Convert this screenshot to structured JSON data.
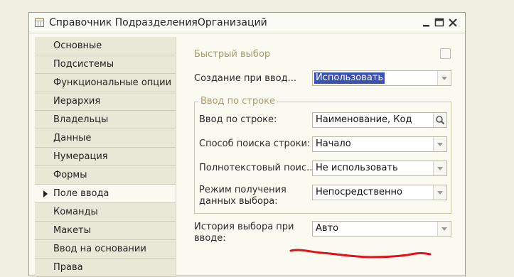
{
  "window": {
    "title": "Справочник ПодразделенияОрганизаций",
    "icons": {
      "app": "table-icon",
      "minimize": "minimize-icon",
      "maximize": "maximize-icon",
      "close": "close-icon"
    }
  },
  "sidebar": {
    "items": [
      {
        "label": "Основные"
      },
      {
        "label": "Подсистемы"
      },
      {
        "label": "Функциональные опции"
      },
      {
        "label": "Иерархия"
      },
      {
        "label": "Владельцы"
      },
      {
        "label": "Данные"
      },
      {
        "label": "Нумерация"
      },
      {
        "label": "Формы"
      },
      {
        "label": "Поле ввода",
        "active": true
      },
      {
        "label": "Команды"
      },
      {
        "label": "Макеты"
      },
      {
        "label": "Ввод на основании"
      },
      {
        "label": "Права"
      }
    ]
  },
  "form": {
    "quick_select": {
      "label": "Быстрый выбор",
      "checked": false
    },
    "create_on_input": {
      "label": "Создание при вводе",
      "label_shown": "Создание при ввод...",
      "value": "Использовать"
    },
    "input_by_string_group": {
      "title": "Ввод по строке",
      "input_by_string": {
        "label": "Ввод по строке:",
        "value": "Наименование, Код"
      },
      "search_method": {
        "label": "Способ поиска строки:",
        "value": "Начало"
      },
      "fulltext_search": {
        "label": "Полнотекстовый поис...",
        "value": "Не использовать"
      },
      "data_mode": {
        "label_line1": "Режим получения",
        "label_line2": "данных выбора:",
        "value": "Непосредственно"
      }
    },
    "history": {
      "label_line1": "История выбора при",
      "label_line2": "вводе:",
      "value": "Авто"
    }
  },
  "colors": {
    "accent_select": "#3a52b0",
    "annotation": "#e0121b",
    "group_title": "#a89a6a"
  }
}
